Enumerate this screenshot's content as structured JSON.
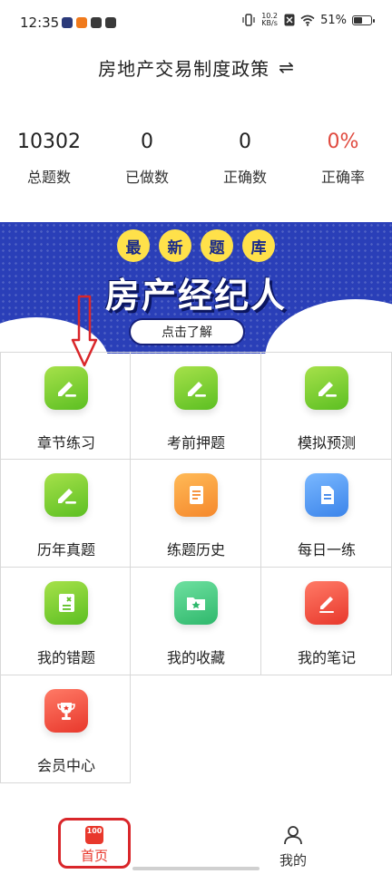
{
  "status_bar": {
    "time": "12:35",
    "net_speed_value": "10.2",
    "net_speed_unit": "KB/s",
    "battery": "51%",
    "battery_level": 0.51
  },
  "header": {
    "title": "房地产交易制度政策",
    "switch_icon": "⇌"
  },
  "stats": {
    "total_value": "10302",
    "total_label": "总题数",
    "done_value": "0",
    "done_label": "已做数",
    "correct_value": "0",
    "correct_label": "正确数",
    "rate_value": "0%",
    "rate_label": "正确率",
    "rate_color": "#e04a3f"
  },
  "banner": {
    "badges": [
      "最",
      "新",
      "题",
      "库"
    ],
    "headline": "房产经纪人",
    "cta": "点击了解",
    "bg_color": "#2a3fb8",
    "badge_color": "#ffe14a"
  },
  "grid": {
    "items": [
      {
        "label": "章节练习",
        "icon": "edit-icon"
      },
      {
        "label": "考前押题",
        "icon": "edit-icon"
      },
      {
        "label": "模拟预测",
        "icon": "edit-icon"
      },
      {
        "label": "历年真题",
        "icon": "edit-icon"
      },
      {
        "label": "练题历史",
        "icon": "scroll-icon"
      },
      {
        "label": "每日一练",
        "icon": "document-icon"
      },
      {
        "label": "我的错题",
        "icon": "wrong-book-icon"
      },
      {
        "label": "我的收藏",
        "icon": "star-folder-icon"
      },
      {
        "label": "我的笔记",
        "icon": "note-pen-icon"
      },
      {
        "label": "会员中心",
        "icon": "trophy-icon"
      }
    ]
  },
  "bottom_nav": {
    "home_label": "首页",
    "home_icon_text": "100",
    "mine_label": "我的",
    "active_color": "#e8382c"
  }
}
